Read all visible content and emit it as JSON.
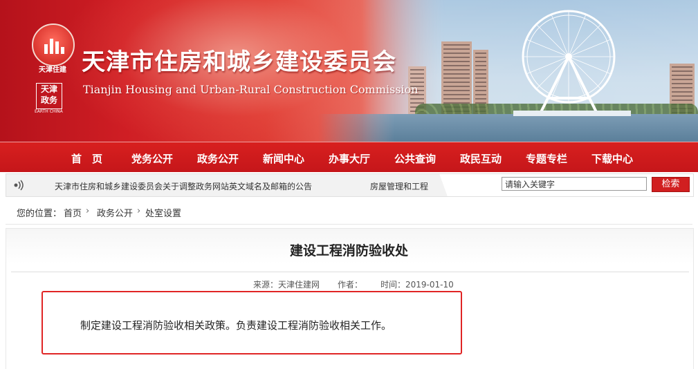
{
  "header": {
    "title_cn": "天津市住房和城乡建设委员会",
    "title_en": "Tianjin Housing and Urban-Rural Construction Commission",
    "logo_text": "天津住建",
    "seal_chars": [
      "天",
      "津",
      "政",
      "务"
    ],
    "seal_caption": "EARTH CHINA"
  },
  "nav": {
    "items": [
      {
        "label": "首　页"
      },
      {
        "label": "党务公开"
      },
      {
        "label": "政务公开"
      },
      {
        "label": "新闻中心"
      },
      {
        "label": "办事大厅"
      },
      {
        "label": "公共查询"
      },
      {
        "label": "政民互动"
      },
      {
        "label": "专题专栏"
      },
      {
        "label": "下载中心"
      }
    ]
  },
  "notice": {
    "text": "天津市住房和城乡建设委员会关于调整政务网站英文域名及邮箱的公告",
    "text2": "房屋管理和工程"
  },
  "search": {
    "value": "请输入关键字",
    "button_label": "检索"
  },
  "breadcrumb": {
    "label": "您的位置：",
    "items": [
      "首页",
      "政务公开",
      "处室设置"
    ],
    "separator": "›"
  },
  "article": {
    "title": "建设工程消防验收处",
    "source": "来源：天津住建网",
    "author": "作者：",
    "date": "时间：2019-01-10",
    "body": "制定建设工程消防验收相关政策。负责建设工程消防验收相关工作。"
  },
  "colors": {
    "brand_red": "#c5161a",
    "highlight_frame": "#e02424"
  },
  "icons": {
    "notice": "speaker-icon",
    "banner_landmark": "ferris-wheel-icon"
  }
}
